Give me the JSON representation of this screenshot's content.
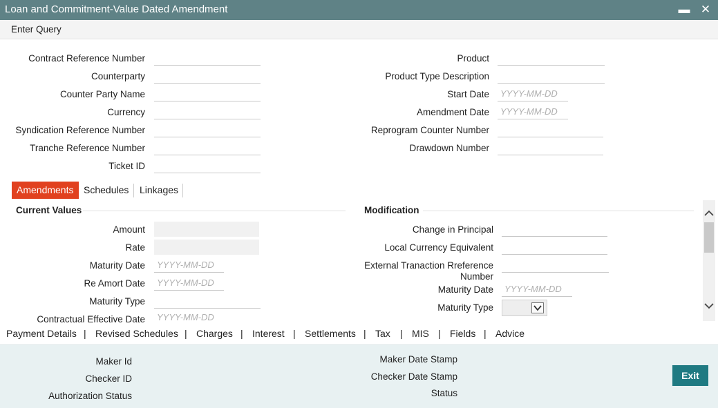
{
  "window": {
    "title": "Loan and Commitment-Value Dated Amendment",
    "minimize_glyph": "▬",
    "close_glyph": "✕"
  },
  "toolbar": {
    "enter_query": "Enter Query"
  },
  "header": {
    "contract_reference_number": {
      "label": "Contract Reference Number",
      "value": ""
    },
    "counterparty": {
      "label": "Counterparty",
      "value": ""
    },
    "counter_party_name": {
      "label": "Counter Party Name",
      "value": ""
    },
    "currency": {
      "label": "Currency",
      "value": ""
    },
    "syndication_reference_number": {
      "label": "Syndication Reference Number",
      "value": ""
    },
    "tranche_reference_number": {
      "label": "Tranche Reference Number",
      "value": ""
    },
    "ticket_id": {
      "label": "Ticket ID",
      "value": ""
    },
    "product": {
      "label": "Product",
      "value": ""
    },
    "product_type_description": {
      "label": "Product Type Description",
      "value": ""
    },
    "start_date": {
      "label": "Start Date",
      "placeholder": "YYYY-MM-DD"
    },
    "amendment_date": {
      "label": "Amendment Date",
      "placeholder": "YYYY-MM-DD"
    },
    "reprogram_counter_number": {
      "label": "Reprogram Counter Number",
      "value": ""
    },
    "drawdown_number": {
      "label": "Drawdown Number",
      "value": ""
    }
  },
  "tabs": [
    {
      "label": "Amendments",
      "active": true
    },
    {
      "label": "Schedules",
      "active": false
    },
    {
      "label": "Linkages",
      "active": false
    }
  ],
  "current_values": {
    "title": "Current Values",
    "amount": {
      "label": "Amount"
    },
    "rate": {
      "label": "Rate"
    },
    "maturity_date": {
      "label": "Maturity Date",
      "placeholder": "YYYY-MM-DD"
    },
    "re_amort_date": {
      "label": "Re Amort Date",
      "placeholder": "YYYY-MM-DD"
    },
    "maturity_type": {
      "label": "Maturity Type"
    },
    "contractual_effective_date": {
      "label": "Contractual Effective Date",
      "placeholder": "YYYY-MM-DD"
    }
  },
  "modification": {
    "title": "Modification",
    "change_in_principal": {
      "label": "Change in Principal"
    },
    "local_currency_equivalent": {
      "label": "Local Currency Equivalent"
    },
    "external_transaction_reference_number": {
      "label_line1": "External Tranaction Rreference",
      "label_line2": "Number"
    },
    "maturity_date": {
      "label": "Maturity Date",
      "placeholder": "YYYY-MM-DD"
    },
    "maturity_type": {
      "label": "Maturity Type",
      "selected": ""
    }
  },
  "links": [
    "Payment Details",
    "Revised Schedules",
    "Charges",
    "Interest",
    "Settlements",
    "Tax",
    "MIS",
    "Fields",
    "Advice"
  ],
  "link_separator": "|",
  "footer": {
    "maker_id": "Maker Id",
    "checker_id": "Checker ID",
    "authorization_status": "Authorization Status",
    "maker_date_stamp": "Maker Date Stamp",
    "checker_date_stamp": "Checker Date Stamp",
    "status": "Status",
    "exit_label": "Exit"
  },
  "colors": {
    "titlebar": "#5f8286",
    "active_tab": "#e1411f",
    "exit_button": "#1f7a82",
    "footer_bg": "#e8f1f2"
  }
}
